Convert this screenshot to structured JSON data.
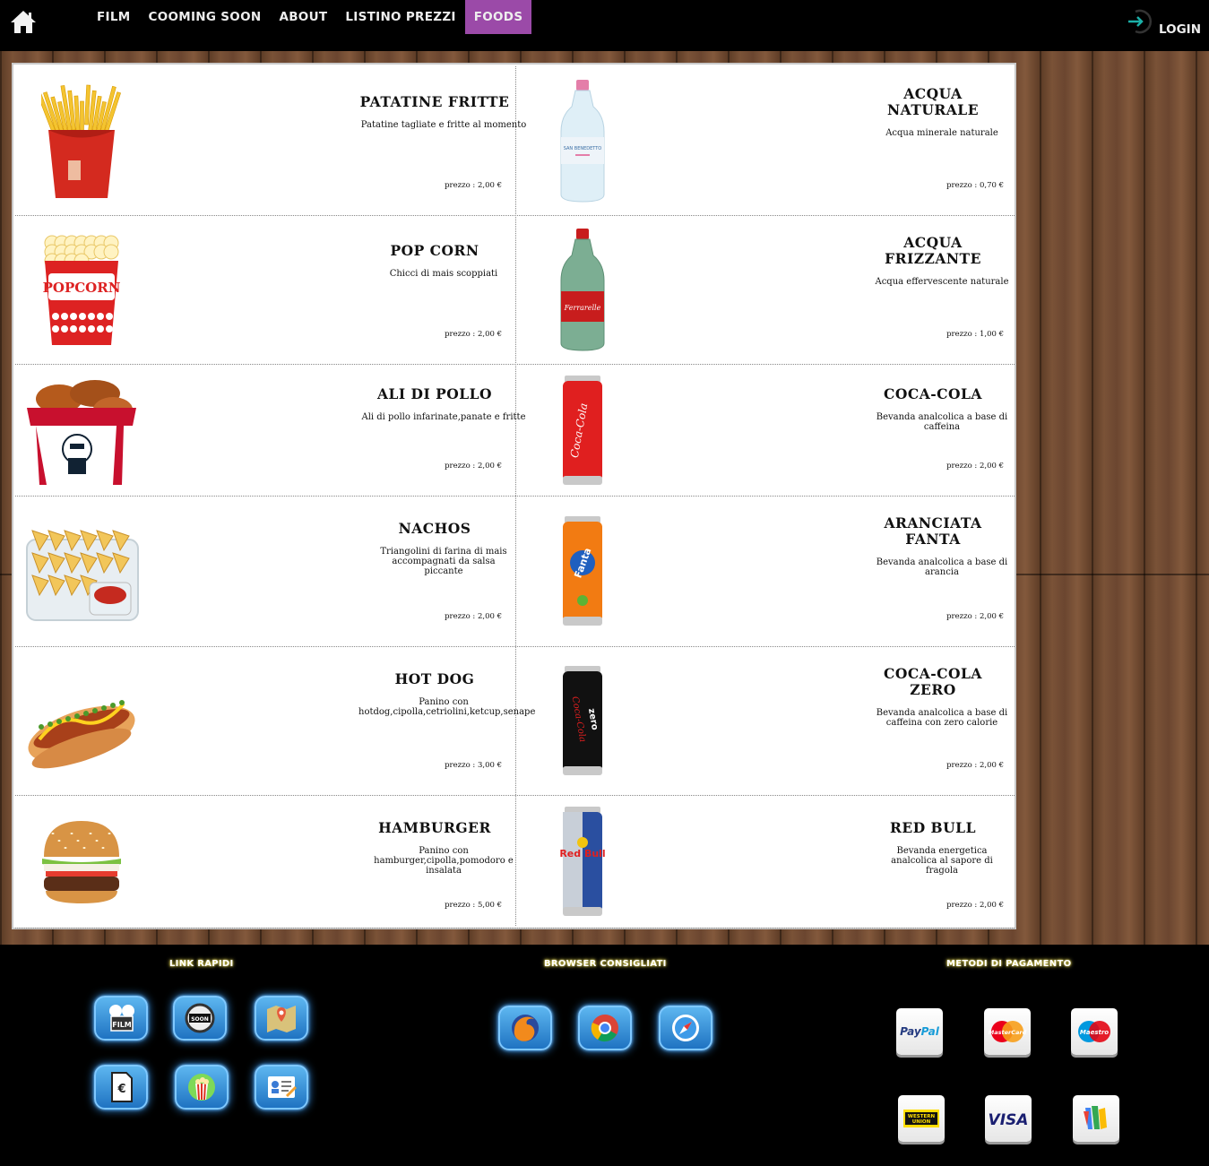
{
  "nav": {
    "home_icon": "home-icon",
    "items": [
      {
        "label": "FILM",
        "active": false
      },
      {
        "label": "COOMING SOON",
        "active": false
      },
      {
        "label": "ABOUT",
        "active": false
      },
      {
        "label": "LISTINO PREZZI",
        "active": false
      },
      {
        "label": "FOODS",
        "active": true
      }
    ],
    "login_label": "LOGIN",
    "login_icon": "login-icon",
    "active_color": "#9b4aa8"
  },
  "foods": [
    {
      "name": "PATATINE FRITTE",
      "desc": "Patatine tagliate e fritte al momento",
      "price": "prezzo : 2,00 €",
      "icon": "french-fries-image"
    },
    {
      "name": "POP CORN",
      "desc": "Chicci di mais scoppiati",
      "price": "prezzo : 2,00 €",
      "icon": "popcorn-image"
    },
    {
      "name": "ALI DI POLLO",
      "desc": "Ali di pollo infarinate,panate e fritte",
      "price": "prezzo : 2,00 €",
      "icon": "chicken-wings-image"
    },
    {
      "name": "NACHOS",
      "desc": "Triangolini di farina di mais accompagnati da salsa piccante",
      "price": "prezzo : 2,00 €",
      "icon": "nachos-image"
    },
    {
      "name": "HOT DOG",
      "desc": "Panino con hotdog,cipolla,cetriolini,ketcup,senape",
      "price": "prezzo : 3,00 €",
      "icon": "hot-dog-image"
    },
    {
      "name": "HAMBURGER",
      "desc": "Panino con hamburger,cipolla,pomodoro e insalata",
      "price": "prezzo : 5,00 €",
      "icon": "hamburger-image"
    }
  ],
  "drinks": [
    {
      "name": "ACQUA NATURALE",
      "desc": "Acqua minerale naturale",
      "price": "prezzo : 0,70 €",
      "icon": "water-bottle-image"
    },
    {
      "name": "ACQUA FRIZZANTE",
      "desc": "Acqua effervescente naturale",
      "price": "prezzo : 1,00 €",
      "icon": "sparkling-water-bottle-image"
    },
    {
      "name": "COCA-COLA",
      "desc": "Bevanda analcolica a base di caffeina",
      "price": "prezzo : 2,00 €",
      "icon": "coca-cola-can-image"
    },
    {
      "name": "ARANCIATA FANTA",
      "desc": "Bevanda analcolica a base di arancia",
      "price": "prezzo : 2,00 €",
      "icon": "fanta-can-image"
    },
    {
      "name": "COCA-COLA ZERO",
      "desc": "Bevanda analcolica a base di caffeina con zero calorie",
      "price": "prezzo : 2,00 €",
      "icon": "coca-cola-zero-can-image"
    },
    {
      "name": "RED BULL",
      "desc": "Bevanda energetica analcolica al sapore di fragola",
      "price": "prezzo : 2,00 €",
      "icon": "red-bull-can-image"
    }
  ],
  "footer": {
    "link_rapidi_title": "LINK RAPIDI",
    "browser_title": "BROWSER CONSIGLIATI",
    "payment_title": "METODI DI PAGAMENTO",
    "quick_links": [
      "film-reel-icon",
      "coming-soon-icon",
      "map-icon",
      "price-list-icon",
      "popcorn-icon",
      "contact-form-icon"
    ],
    "browsers": [
      "firefox-icon",
      "chrome-icon",
      "safari-icon"
    ],
    "payments": [
      {
        "icon": "paypal-logo",
        "label": "PayPal"
      },
      {
        "icon": "mastercard-logo",
        "label": "MasterCard"
      },
      {
        "icon": "maestro-logo",
        "label": "Maestro"
      },
      {
        "icon": "western-union-logo",
        "label": "WESTERN UNION"
      },
      {
        "icon": "visa-logo",
        "label": "VISA"
      },
      {
        "icon": "google-wallet-logo",
        "label": ""
      }
    ]
  }
}
